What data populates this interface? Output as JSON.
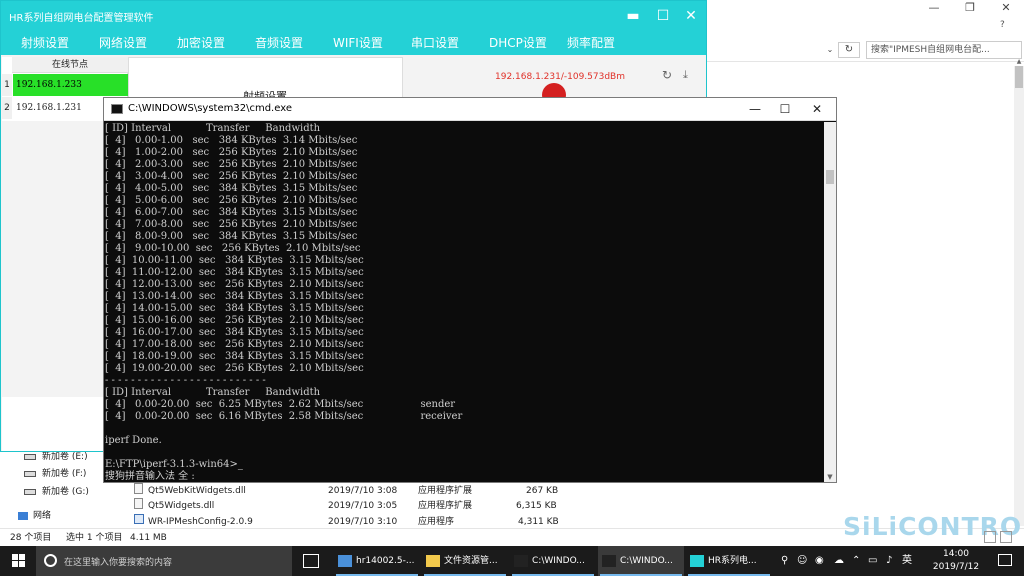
{
  "explorer": {
    "search_placeholder": "搜索\"IPMESH自组网电台配...",
    "nav_items": [
      "新加卷 (E:)",
      "新加卷 (F:)",
      "新加卷 (G:)",
      "网络"
    ],
    "files": [
      {
        "name": "Qt5WebKitWidgets.dll",
        "date": "2019/7/10 3:08",
        "type": "应用程序扩展",
        "size": "267 KB"
      },
      {
        "name": "Qt5Widgets.dll",
        "date": "2019/7/10 3:05",
        "type": "应用程序扩展",
        "size": "6,315 KB"
      },
      {
        "name": "WR-IPMeshConfig-2.0.9",
        "date": "2019/7/10 3:10",
        "type": "应用程序",
        "size": "4,311 KB"
      }
    ],
    "status": {
      "count": "28 个项目",
      "selected": "选中 1 个项目",
      "size": "4.11 MB"
    },
    "watermark": "SiLiCONTROL"
  },
  "hr_app": {
    "title": "HR系列自组网电台配置管理软件",
    "menu": [
      "射频设置",
      "网络设置",
      "加密设置",
      "音频设置",
      "WIFI设置",
      "串口设置",
      "DHCP设置",
      "频率配置"
    ],
    "node_header": "在线节点",
    "nodes": [
      {
        "index": "1",
        "ip": "192.168.1.233"
      },
      {
        "index": "2",
        "ip": "192.168.1.231"
      }
    ],
    "center_title": "射频设置",
    "signal": "192.168.1.231/-109.573dBm"
  },
  "cmd": {
    "title": "C:\\WINDOWS\\system32\\cmd.exe",
    "header": "[ ID] Interval           Transfer     Bandwidth",
    "rows": [
      "[  4]   0.00-1.00   sec   384 KBytes  3.14 Mbits/sec",
      "[  4]   1.00-2.00   sec   256 KBytes  2.10 Mbits/sec",
      "[  4]   2.00-3.00   sec   256 KBytes  2.10 Mbits/sec",
      "[  4]   3.00-4.00   sec   256 KBytes  2.10 Mbits/sec",
      "[  4]   4.00-5.00   sec   384 KBytes  3.15 Mbits/sec",
      "[  4]   5.00-6.00   sec   256 KBytes  2.10 Mbits/sec",
      "[  4]   6.00-7.00   sec   384 KBytes  3.15 Mbits/sec",
      "[  4]   7.00-8.00   sec   256 KBytes  2.10 Mbits/sec",
      "[  4]   8.00-9.00   sec   384 KBytes  3.15 Mbits/sec",
      "[  4]   9.00-10.00  sec   256 KBytes  2.10 Mbits/sec",
      "[  4]  10.00-11.00  sec   384 KBytes  3.15 Mbits/sec",
      "[  4]  11.00-12.00  sec   384 KBytes  3.15 Mbits/sec",
      "[  4]  12.00-13.00  sec   256 KBytes  2.10 Mbits/sec",
      "[  4]  13.00-14.00  sec   384 KBytes  3.15 Mbits/sec",
      "[  4]  14.00-15.00  sec   384 KBytes  3.15 Mbits/sec",
      "[  4]  15.00-16.00  sec   256 KBytes  2.10 Mbits/sec",
      "[  4]  16.00-17.00  sec   384 KBytes  3.15 Mbits/sec",
      "[  4]  17.00-18.00  sec   256 KBytes  2.10 Mbits/sec",
      "[  4]  18.00-19.00  sec   384 KBytes  3.15 Mbits/sec",
      "[  4]  19.00-20.00  sec   256 KBytes  2.10 Mbits/sec"
    ],
    "separator": "- - - - - - - - - - - - - - - - - - - - - - - - -",
    "summary_header": "[ ID] Interval           Transfer     Bandwidth",
    "summary_rows": [
      "[  4]   0.00-20.00  sec  6.25 MBytes  2.62 Mbits/sec                  sender",
      "[  4]   0.00-20.00  sec  6.16 MBytes  2.58 Mbits/sec                  receiver"
    ],
    "done": "iperf Done.",
    "prompt": "E:\\FTP\\iperf-3.1.3-win64>",
    "ime": "搜狗拼音输入法 全 :"
  },
  "taskbar": {
    "search_placeholder": "在这里输入你要搜索的内容",
    "apps": [
      {
        "label": "hr14002.5-...",
        "icon": "browser-icon",
        "color": "#4a90d9"
      },
      {
        "label": "文件资源管...",
        "icon": "folder-icon",
        "color": "#f2c94c"
      },
      {
        "label": "C:\\WINDO...",
        "icon": "cmd-icon",
        "color": "#222222"
      },
      {
        "label": "C:\\WINDO...",
        "icon": "cmd-icon",
        "color": "#222222"
      },
      {
        "label": "HR系列电...",
        "icon": "app-icon",
        "color": "#24d1d6"
      }
    ],
    "ime_lang": "英",
    "time": "14:00",
    "date": "2019/7/12"
  },
  "colors": {
    "hr_accent": "#24d1d6",
    "node_selected": "#28e028",
    "signal_text": "#e0322a"
  }
}
